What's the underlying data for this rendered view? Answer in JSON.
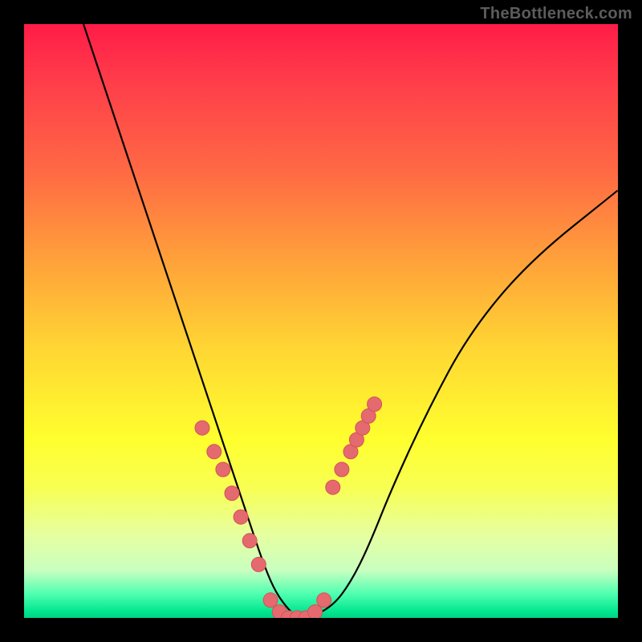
{
  "watermark": "TheBottleneck.com",
  "chart_data": {
    "type": "line",
    "title": "",
    "xlabel": "",
    "ylabel": "",
    "xlim": [
      0,
      100
    ],
    "ylim": [
      0,
      100
    ],
    "grid": false,
    "legend": false,
    "series": [
      {
        "name": "bottleneck-curve",
        "x": [
          10,
          15,
          20,
          25,
          30,
          34,
          36,
          38,
          40,
          42,
          44,
          46,
          48,
          52,
          55,
          58,
          62,
          68,
          75,
          85,
          100
        ],
        "y": [
          100,
          85,
          70,
          55,
          40,
          28,
          22,
          16,
          10,
          5,
          2,
          0,
          0,
          2,
          6,
          12,
          22,
          35,
          48,
          60,
          72
        ]
      }
    ],
    "markers": {
      "left_cluster": {
        "x": [
          30.0,
          32.0,
          33.5,
          35.0,
          36.5,
          38.0,
          39.5
        ],
        "y": [
          32,
          28,
          25,
          21,
          17,
          13,
          9
        ]
      },
      "right_cluster": {
        "x": [
          52.0,
          53.5,
          55.0,
          56.0,
          57.0,
          58.0,
          59.0
        ],
        "y": [
          22,
          25,
          28,
          30,
          32,
          34,
          36
        ]
      },
      "bottom_cluster": {
        "x": [
          41.5,
          43.0,
          44.5,
          46.0,
          47.5,
          49.0,
          50.5
        ],
        "y": [
          3,
          1,
          0,
          0,
          0,
          1,
          3
        ]
      }
    },
    "colors": {
      "curve": "#000000",
      "marker_fill": "#e46a6f",
      "marker_stroke": "#d45258",
      "gradient_top": "#ff1c48",
      "gradient_bottom": "#00d284"
    }
  }
}
